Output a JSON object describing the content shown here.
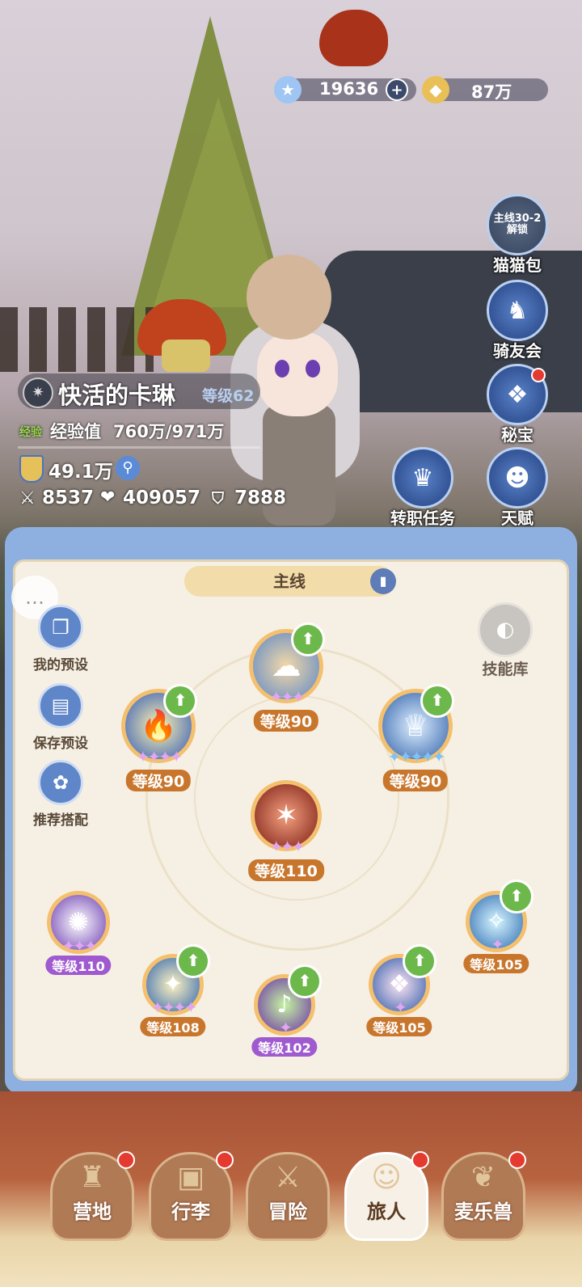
{
  "currency": {
    "stars": "19636",
    "stars_add": "+",
    "coins": "87万"
  },
  "right_menu": [
    {
      "lock_text": "主线30-2\n解锁",
      "label": "猫猫包"
    },
    {
      "label": "骑友会"
    },
    {
      "label": "秘宝",
      "badge": true
    },
    {
      "label": "天赋"
    }
  ],
  "job_quest": {
    "label": "转职任务"
  },
  "player": {
    "name": "快活的卡琳",
    "level": "等级62",
    "exp_tag": "经验",
    "exp_label": "经验值",
    "exp_value": "760万/971万",
    "power": "49.1万",
    "attack": "8537",
    "hp": "409057",
    "defense": "7888"
  },
  "skill_panel": {
    "tab": "主线",
    "side_buttons": [
      "我的预设",
      "保存预设",
      "推荐搭配"
    ],
    "skill_library": "技能库",
    "skills": [
      {
        "name": "skill-top",
        "level": "等级90",
        "upgrade": true,
        "stars": 3,
        "star_color": "pink"
      },
      {
        "name": "skill-left",
        "level": "等级90",
        "upgrade": true,
        "stars": 4,
        "star_color": "pink"
      },
      {
        "name": "skill-right",
        "level": "等级90",
        "upgrade": true,
        "stars": 5,
        "star_color": "blue"
      },
      {
        "name": "skill-center",
        "level": "等级110",
        "upgrade": false,
        "stars": 3,
        "star_color": "pink"
      },
      {
        "name": "skill-b1",
        "level": "等级110",
        "upgrade": false,
        "stars": 3,
        "star_color": "pink"
      },
      {
        "name": "skill-b2",
        "level": "等级108",
        "upgrade": true,
        "stars": 4,
        "star_color": "pink"
      },
      {
        "name": "skill-b3",
        "level": "等级102",
        "upgrade": true,
        "stars": 1,
        "star_color": "pink"
      },
      {
        "name": "skill-b4",
        "level": "等级105",
        "upgrade": true,
        "stars": 1,
        "star_color": "pink"
      },
      {
        "name": "skill-b5",
        "level": "等级105",
        "upgrade": true,
        "stars": 1,
        "star_color": "pink"
      }
    ]
  },
  "bottom_nav": [
    {
      "label": "营地",
      "badge": true
    },
    {
      "label": "行李",
      "badge": true
    },
    {
      "label": "冒险",
      "badge": false
    },
    {
      "label": "旅人",
      "badge": true,
      "active": true
    },
    {
      "label": "麦乐兽",
      "badge": true
    }
  ],
  "colors": {
    "panel_blue": "#8db0e0",
    "panel_cream": "#f6f0e4",
    "level_orange": "#c9762d",
    "level_purple": "#a05ad0",
    "upgrade_green": "#6cb84a",
    "badge_red": "#e53a2f"
  }
}
